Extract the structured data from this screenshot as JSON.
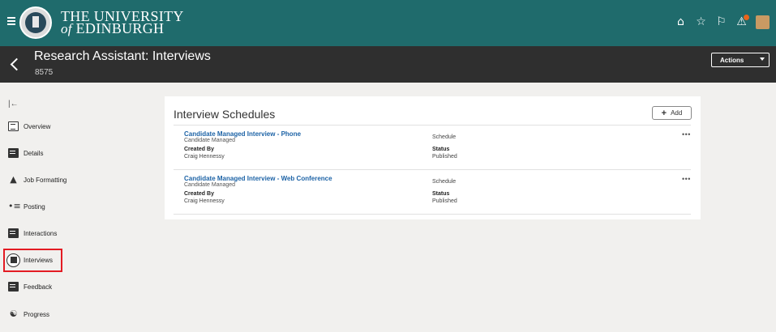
{
  "header": {
    "university_line1": "THE UNIVERSITY",
    "university_line2_prefix": "of",
    "university_line2": "EDINBURGH",
    "icons": [
      "home-icon",
      "star-icon",
      "flag-icon",
      "notifications-icon",
      "user-avatar"
    ]
  },
  "subheader": {
    "title": "Research Assistant: Interviews",
    "number": "8575",
    "actions_label": "Actions"
  },
  "sidebar": {
    "items": [
      {
        "label": "Overview",
        "icon": "overview-icon"
      },
      {
        "label": "Details",
        "icon": "details-icon"
      },
      {
        "label": "Job Formatting",
        "icon": "job-formatting-icon"
      },
      {
        "label": "Posting",
        "icon": "posting-icon"
      },
      {
        "label": "Interactions",
        "icon": "interactions-icon"
      },
      {
        "label": "Interviews",
        "icon": "interviews-icon"
      },
      {
        "label": "Feedback",
        "icon": "feedback-icon"
      },
      {
        "label": "Progress",
        "icon": "progress-icon"
      }
    ],
    "highlighted": "Interviews"
  },
  "main": {
    "card_title": "Interview Schedules",
    "add_label": "Add",
    "schedules": [
      {
        "title": "Candidate Managed Interview - Phone",
        "subtitle": "Candidate Managed",
        "created_by_label": "Created By",
        "created_by": "Craig Hennessy",
        "schedule_label": "Schedule",
        "status_label": "Status",
        "status": "Published",
        "more": "•••"
      },
      {
        "title": "Candidate Managed Interview - Web Conference",
        "subtitle": "Candidate Managed",
        "created_by_label": "Created By",
        "created_by": "Craig Hennessy",
        "schedule_label": "Schedule",
        "status_label": "Status",
        "status": "Published",
        "more": "•••"
      }
    ]
  },
  "colors": {
    "topbar": "#1f6b6c",
    "subbar": "#2f2f2f",
    "link": "#1d63a6",
    "highlight": "#e31b23"
  }
}
